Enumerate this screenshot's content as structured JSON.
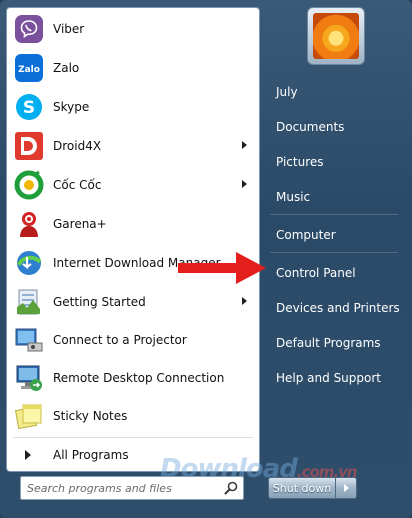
{
  "programs": [
    {
      "label": "Viber",
      "icon": "viber-icon",
      "submenu": false
    },
    {
      "label": "Zalo",
      "icon": "zalo-icon",
      "submenu": false
    },
    {
      "label": "Skype",
      "icon": "skype-icon",
      "submenu": false
    },
    {
      "label": "Droid4X",
      "icon": "droid4x-icon",
      "submenu": true
    },
    {
      "label": "Cốc Cốc",
      "icon": "coccoc-icon",
      "submenu": true
    },
    {
      "label": "Garena+",
      "icon": "garena-icon",
      "submenu": false
    },
    {
      "label": "Internet Download Manager",
      "icon": "idm-icon",
      "submenu": false
    },
    {
      "label": "Getting Started",
      "icon": "getting-started-icon",
      "submenu": true
    },
    {
      "label": "Connect to a Projector",
      "icon": "projector-icon",
      "submenu": false
    },
    {
      "label": "Remote Desktop Connection",
      "icon": "remote-desktop-icon",
      "submenu": false
    },
    {
      "label": "Sticky Notes",
      "icon": "sticky-notes-icon",
      "submenu": false
    }
  ],
  "all_programs": {
    "label": "All Programs"
  },
  "search": {
    "placeholder": "Search programs and files"
  },
  "right_items": [
    {
      "label": "July"
    },
    {
      "label": "Documents"
    },
    {
      "label": "Pictures"
    },
    {
      "label": "Music"
    },
    {
      "label": "Computer"
    },
    {
      "label": "Control Panel"
    },
    {
      "label": "Devices and Printers"
    },
    {
      "label": "Default Programs"
    },
    {
      "label": "Help and Support"
    }
  ],
  "shutdown": {
    "label": "Shut down"
  },
  "icons": {
    "zalo_text": "Zalo"
  },
  "watermark": {
    "text": "Download",
    "suffix": ".com.vn"
  },
  "colors": {
    "menu_bg": "#2e4e6c",
    "annotation_arrow": "#e41d1d",
    "viber": "#7b519d",
    "zalo": "#0a6fd8",
    "skype": "#00aff0",
    "droid4x": "#e03a2e"
  }
}
